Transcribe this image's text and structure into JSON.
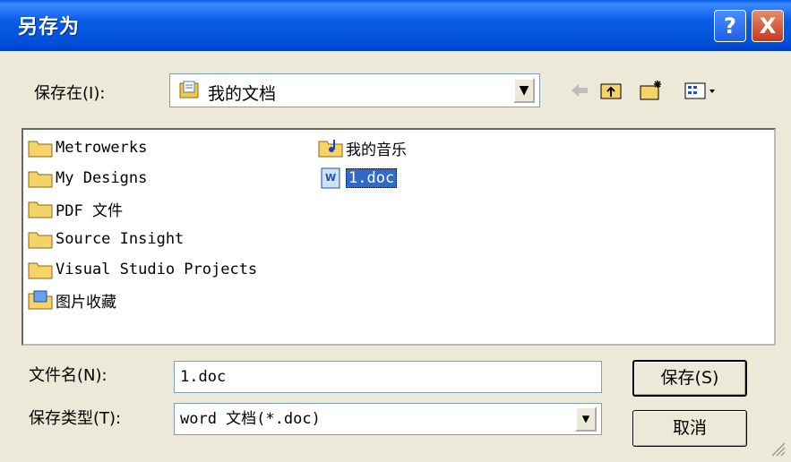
{
  "window": {
    "title": "另存为"
  },
  "title_buttons": {
    "help": "?",
    "close": "X"
  },
  "toolbar": {
    "save_in_label": "保存在(I):",
    "save_in_value": "我的文档"
  },
  "files": [
    {
      "name": "Metrowerks",
      "type": "folder"
    },
    {
      "name": "My Designs",
      "type": "folder"
    },
    {
      "name": "PDF 文件",
      "type": "folder"
    },
    {
      "name": "Source Insight",
      "type": "folder"
    },
    {
      "name": "Visual Studio Projects",
      "type": "folder"
    },
    {
      "name": "图片收藏",
      "type": "pictures"
    },
    {
      "name": "我的音乐",
      "type": "music"
    },
    {
      "name": "1.doc",
      "type": "doc",
      "selected": true
    }
  ],
  "form": {
    "filename_label": "文件名(N):",
    "filename_value": "1.doc",
    "filetype_label": "保存类型(T):",
    "filetype_value": "word 文档(*.doc)"
  },
  "buttons": {
    "save": "保存(S)",
    "cancel": "取消"
  }
}
